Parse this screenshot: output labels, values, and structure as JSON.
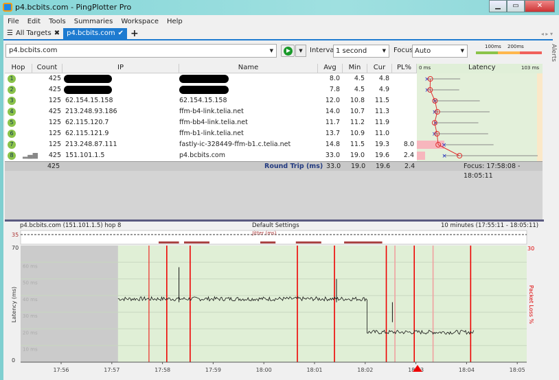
{
  "window": {
    "title": "p4.bcbits.com - PingPlotter Pro",
    "min": "▁",
    "max": "▭",
    "close": "✕"
  },
  "menu": [
    "File",
    "Edit",
    "Tools",
    "Summaries",
    "Workspace",
    "Help"
  ],
  "tabs": [
    {
      "label": "All Targets",
      "icon": "close-icon",
      "glyph": "✖"
    },
    {
      "label": "p4.bcbits.com",
      "icon": "check-icon",
      "glyph": "✔"
    }
  ],
  "add_tab": "+",
  "toolbar": {
    "target": "p4.bcbits.com",
    "interval_label": "Interval",
    "interval": "1 second",
    "focus_label": "Focus",
    "focus": "Auto",
    "scale_100": "100ms",
    "scale_200": "200ms",
    "alerts": "Alerts"
  },
  "colors": {
    "good": "#8bc34a",
    "warn": "#ffb74d",
    "bad": "#f0605a",
    "accent": "#1e7bd0"
  },
  "columns": {
    "hop": "Hop",
    "count": "Count",
    "ip": "IP",
    "name": "Name",
    "avg": "Avg",
    "min": "Min",
    "cur": "Cur",
    "pl": "PL%",
    "lat_min": "0 ms",
    "latency": "Latency",
    "lat_max": "103 ms"
  },
  "hops": [
    {
      "hop": "1",
      "count": "425",
      "ip": "",
      "name": "",
      "avg": "8.0",
      "min": "4.5",
      "cur": "4.8",
      "pl": ""
    },
    {
      "hop": "2",
      "count": "425",
      "ip": "",
      "name": "",
      "avg": "7.8",
      "min": "4.5",
      "cur": "4.9",
      "pl": ""
    },
    {
      "hop": "3",
      "count": "125",
      "ip": "62.154.15.158",
      "name": "62.154.15.158",
      "avg": "12.0",
      "min": "10.8",
      "cur": "11.5",
      "pl": ""
    },
    {
      "hop": "4",
      "count": "425",
      "ip": "213.248.93.186",
      "name": "ffm-b4-link.telia.net",
      "avg": "14.0",
      "min": "10.7",
      "cur": "11.3",
      "pl": ""
    },
    {
      "hop": "5",
      "count": "125",
      "ip": "62.115.120.7",
      "name": "ffm-bb4-link.telia.net",
      "avg": "11.7",
      "min": "11.2",
      "cur": "11.9",
      "pl": ""
    },
    {
      "hop": "6",
      "count": "125",
      "ip": "62.115.121.9",
      "name": "ffm-b1-link.telia.net",
      "avg": "13.7",
      "min": "10.9",
      "cur": "11.0",
      "pl": ""
    },
    {
      "hop": "7",
      "count": "125",
      "ip": "213.248.87.111",
      "name": "fastly-ic-328449-ffm-b1.c.telia.net",
      "avg": "14.8",
      "min": "11.5",
      "cur": "19.3",
      "pl": "8.0"
    },
    {
      "hop": "8",
      "count": "425",
      "ip": "151.101.1.5",
      "name": "p4.bcbits.com",
      "avg": "33.0",
      "min": "19.0",
      "cur": "19.6",
      "pl": "2.4"
    }
  ],
  "summary": {
    "count": "425",
    "label": "Round Trip (ms)",
    "avg": "33.0",
    "min": "19.0",
    "cur": "19.6",
    "pl": "2.4",
    "focus": "Focus: 17:58:08 - 18:05:11"
  },
  "graph": {
    "target": "p4.bcbits.com (151.101.1.5) hop 8",
    "settings": "Default Settings",
    "range": "10 minutes (17:55:11 - 18:05:11)",
    "jitter_label": "Jitter (ms)",
    "jitter_max": "35"
  },
  "chart_data": {
    "type": "line",
    "ylabel": "Latency (ms)",
    "y2label": "Packet Loss %",
    "ylim": [
      0,
      70
    ],
    "y2max": "30",
    "ymax_label": "70",
    "ymin_label": "0",
    "yticks": [
      "60 ms",
      "50 ms",
      "40 ms",
      "30 ms",
      "20 ms",
      "10 ms"
    ],
    "xticks": [
      "17:56",
      "17:57",
      "17:58",
      "17:59",
      "18:00",
      "18:01",
      "18:02",
      "18:03",
      "18:04",
      "18:05"
    ],
    "data_start_min": 2.2,
    "segments": [
      {
        "from_min": 2.2,
        "to_min": 7.1,
        "ms": 38
      },
      {
        "from_min": 7.1,
        "to_min": 9.2,
        "ms": 18
      }
    ],
    "spikes": [
      {
        "min": 3.4,
        "ms": 57
      },
      {
        "min": 6.5,
        "ms": 50
      },
      {
        "min": 7.6,
        "ms": 24
      }
    ],
    "loss_events_min": [
      2.81,
      3.16,
      3.62,
      5.73,
      6.46,
      7.48,
      7.65,
      8.03,
      8.4,
      9.14
    ],
    "jitter_bars": [
      [
        3.0,
        3.4
      ],
      [
        3.5,
        4.0
      ],
      [
        5.0,
        5.3
      ],
      [
        5.7,
        6.2
      ],
      [
        6.65,
        7.4
      ]
    ]
  }
}
